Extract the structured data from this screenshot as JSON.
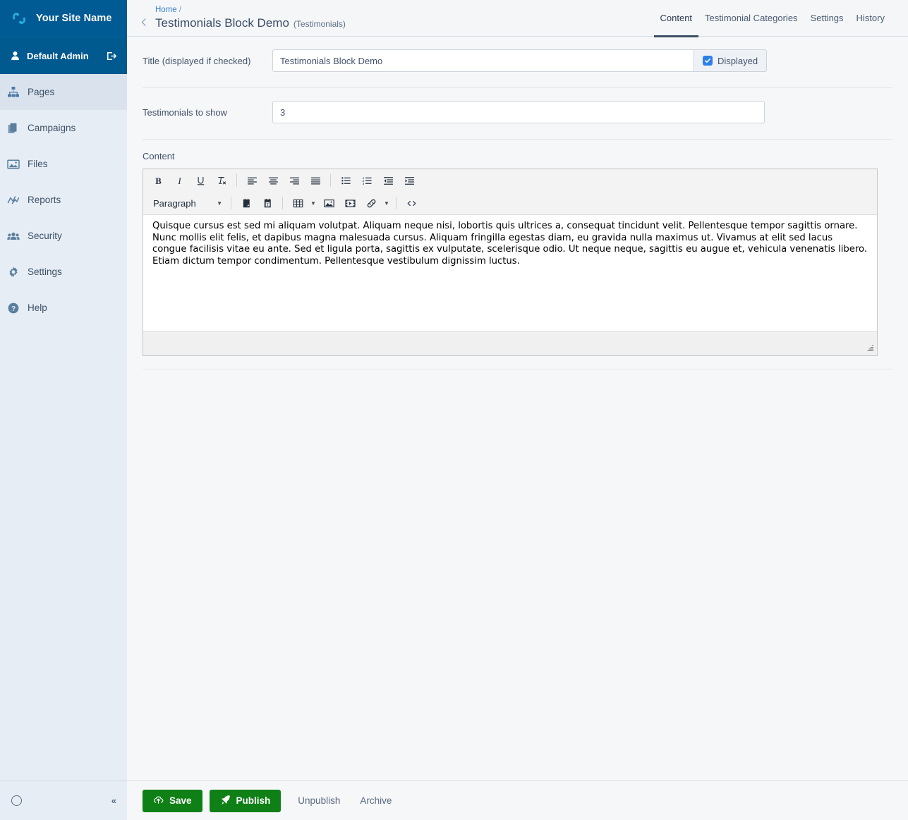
{
  "sidebar": {
    "brand": {
      "name": "Your Site Name",
      "logo_icon": "silverstripe-logo-icon"
    },
    "profile": {
      "name": "Default Admin",
      "icon": "user-icon",
      "logout_icon": "logout-icon"
    },
    "items": [
      {
        "label": "Pages",
        "icon": "sitemap-icon",
        "active": true
      },
      {
        "label": "Campaigns",
        "icon": "campaigns-icon",
        "active": false
      },
      {
        "label": "Files",
        "icon": "image-icon",
        "active": false
      },
      {
        "label": "Reports",
        "icon": "chart-line-icon",
        "active": false
      },
      {
        "label": "Security",
        "icon": "users-icon",
        "active": false
      },
      {
        "label": "Settings",
        "icon": "gear-icon",
        "active": false
      },
      {
        "label": "Help",
        "icon": "help-circle-icon",
        "active": false
      }
    ],
    "footer": {
      "spinner_icon": "loading-circle-icon",
      "collapse_label": "«"
    }
  },
  "header": {
    "back_icon": "chevron-left-icon",
    "breadcrumb_home": "Home",
    "breadcrumb_separator": "/",
    "title": "Testimonials Block Demo",
    "subtitle": "(Testimonials)",
    "tabs": [
      {
        "label": "Content",
        "active": true
      },
      {
        "label": "Testimonial Categories",
        "active": false
      },
      {
        "label": "Settings",
        "active": false
      },
      {
        "label": "History",
        "active": false
      }
    ]
  },
  "form": {
    "title_field": {
      "label": "Title (displayed if checked)",
      "value": "Testimonials Block Demo",
      "placeholder": "",
      "checkbox_label": "Displayed",
      "checkbox_checked": true,
      "check_icon": "check-icon"
    },
    "count_field": {
      "label": "Testimonials to show",
      "value": "3",
      "placeholder": ""
    },
    "content_field": {
      "label": "Content",
      "body": "Quisque cursus est sed mi aliquam volutpat. Aliquam neque nisi, lobortis quis ultrices a, consequat tincidunt velit. Pellentesque tempor sagittis ornare. Nunc mollis elit felis, et dapibus magna malesuada cursus. Aliquam fringilla egestas diam, eu gravida nulla maximus ut. Vivamus at elit sed lacus congue facilisis vitae eu ante. Sed et ligula porta, sagittis ex vulputate, scelerisque odio. Ut neque neque, sagittis eu augue et, vehicula venenatis libero. Etiam dictum tempor condimentum. Pellentesque vestibulum dignissim luctus."
    }
  },
  "editor": {
    "format_select": "Paragraph",
    "row1": [
      {
        "icon": "bold-icon",
        "name": "bold"
      },
      {
        "icon": "italic-icon",
        "name": "italic"
      },
      {
        "icon": "underline-icon",
        "name": "underline"
      },
      {
        "icon": "remove-format-icon",
        "name": "remove-format"
      },
      {
        "icon": "align-left-icon",
        "name": "align-left"
      },
      {
        "icon": "align-center-icon",
        "name": "align-center"
      },
      {
        "icon": "align-right-icon",
        "name": "align-right"
      },
      {
        "icon": "align-justify-icon",
        "name": "align-justify"
      },
      {
        "icon": "bullet-list-icon",
        "name": "bullet-list"
      },
      {
        "icon": "numbered-list-icon",
        "name": "numbered-list"
      },
      {
        "icon": "outdent-icon",
        "name": "outdent"
      },
      {
        "icon": "indent-icon",
        "name": "indent"
      }
    ],
    "row2": [
      {
        "icon": "paste-icon",
        "name": "paste"
      },
      {
        "icon": "paste-text-icon",
        "name": "paste-as-text"
      },
      {
        "icon": "table-icon",
        "name": "insert-table"
      },
      {
        "icon": "image-icon",
        "name": "insert-image"
      },
      {
        "icon": "media-icon",
        "name": "insert-media"
      },
      {
        "icon": "link-icon",
        "name": "insert-link"
      },
      {
        "icon": "source-code-icon",
        "name": "source-code"
      }
    ],
    "resize_icon": "resize-handle-icon"
  },
  "actions": {
    "save": {
      "label": "Save",
      "icon": "cloud-upload-icon"
    },
    "publish": {
      "label": "Publish",
      "icon": "rocket-icon"
    },
    "unpublish": {
      "label": "Unpublish"
    },
    "archive": {
      "label": "Archive"
    }
  },
  "colors": {
    "brand_blue": "#005a93",
    "profile_blue": "#00598f",
    "sidebar_bg": "#e6edf5",
    "sidebar_active": "#dae3ed",
    "accent_link": "#3b7ed0",
    "checkbox_blue": "#2f7fe8",
    "action_green": "#0f8016",
    "body_bg": "#f6f7f8"
  }
}
